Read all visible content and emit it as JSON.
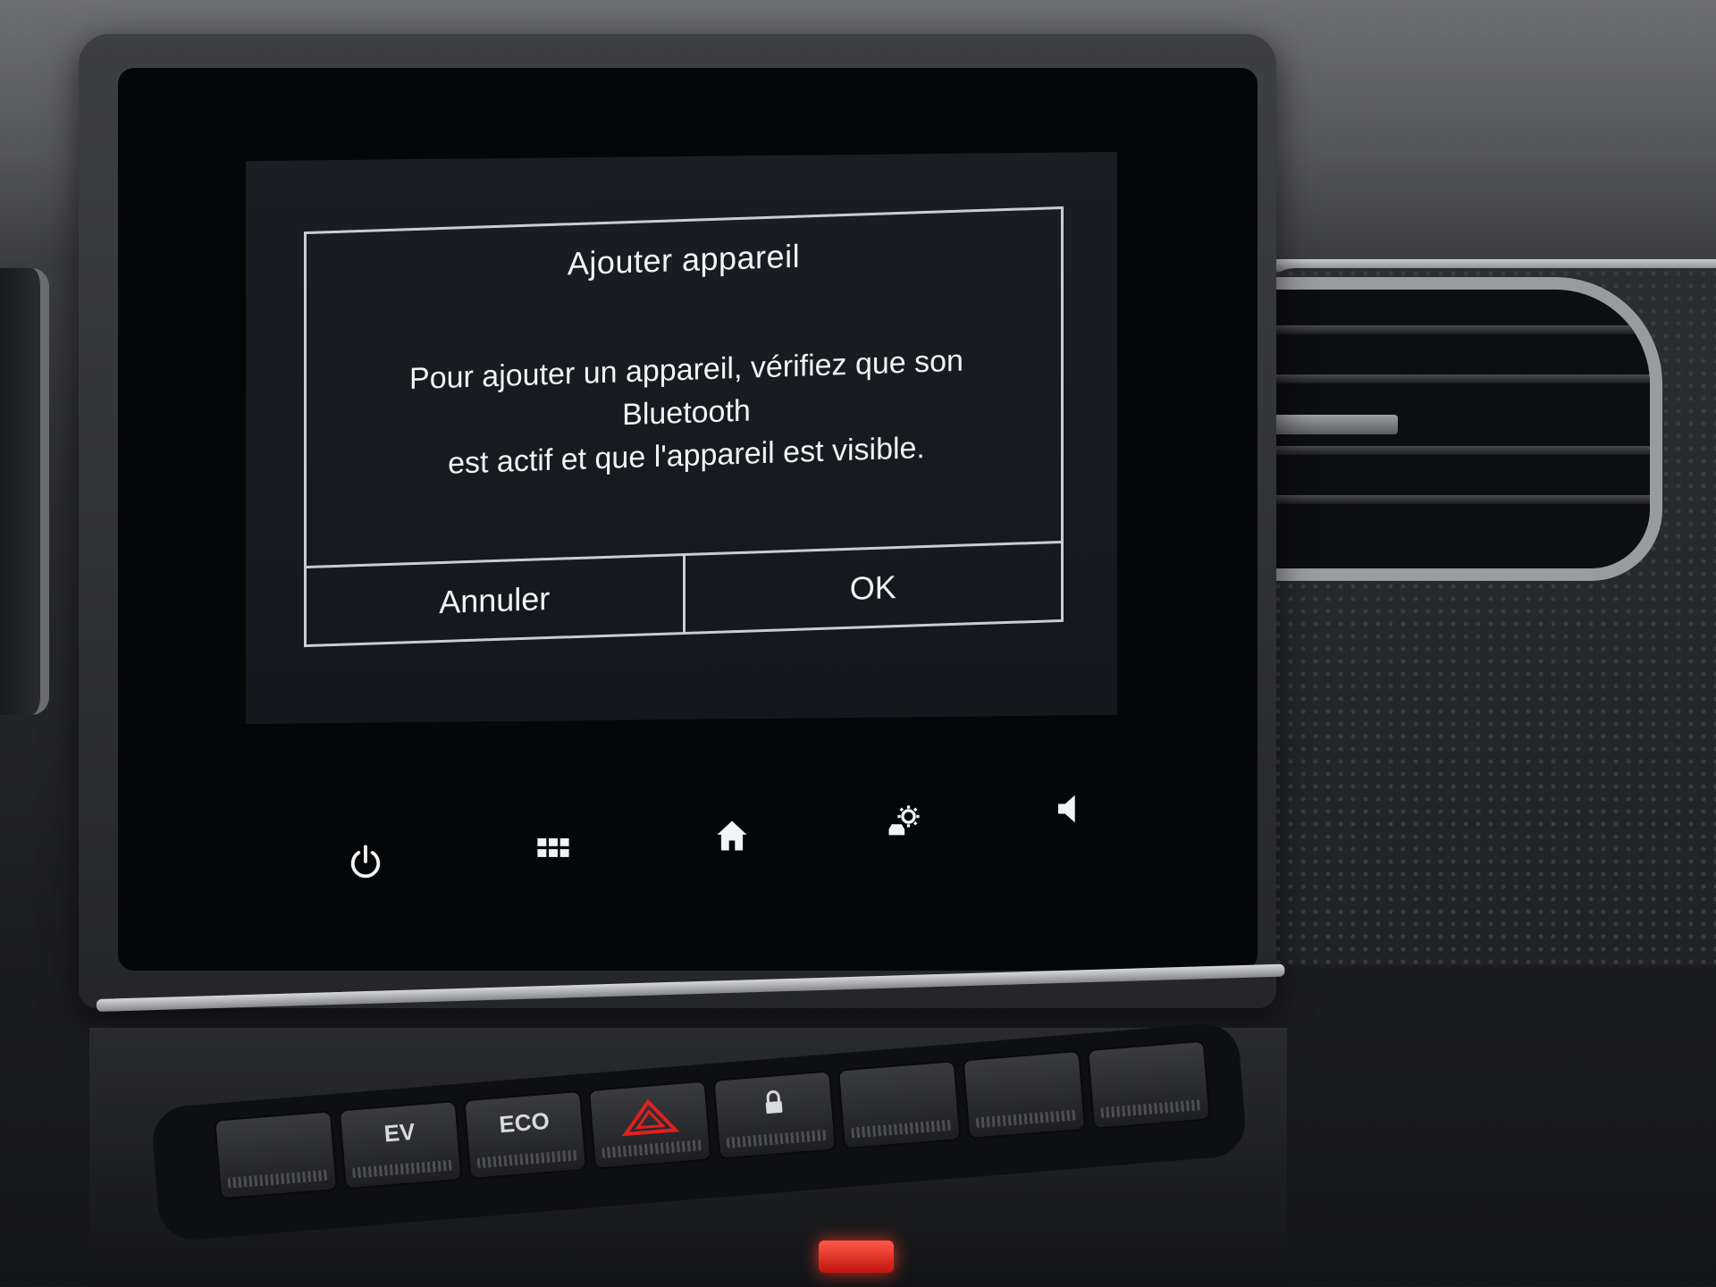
{
  "dialog": {
    "title": "Ajouter appareil",
    "message_line1": "Pour ajouter un appareil, vérifiez que son Bluetooth",
    "message_line2": "est actif et que l'appareil est visible.",
    "cancel_label": "Annuler",
    "ok_label": "OK"
  },
  "nav_bar": {
    "icons": [
      "power-icon",
      "apps-grid-icon",
      "home-icon",
      "car-settings-icon",
      "volume-icon"
    ]
  },
  "console_switches": [
    {
      "label": "",
      "icon": "none"
    },
    {
      "label": "EV",
      "icon": "none"
    },
    {
      "label": "ECO",
      "icon": "none"
    },
    {
      "label": "",
      "icon": "hazard-icon"
    },
    {
      "label": "",
      "icon": "lock-icon"
    },
    {
      "label": "",
      "icon": "none"
    },
    {
      "label": "",
      "icon": "none"
    },
    {
      "label": "",
      "icon": "none"
    }
  ],
  "colors": {
    "screen_text": "#f2f3f5",
    "dialog_border": "#c8cdd6",
    "hazard_red": "#e02020"
  }
}
